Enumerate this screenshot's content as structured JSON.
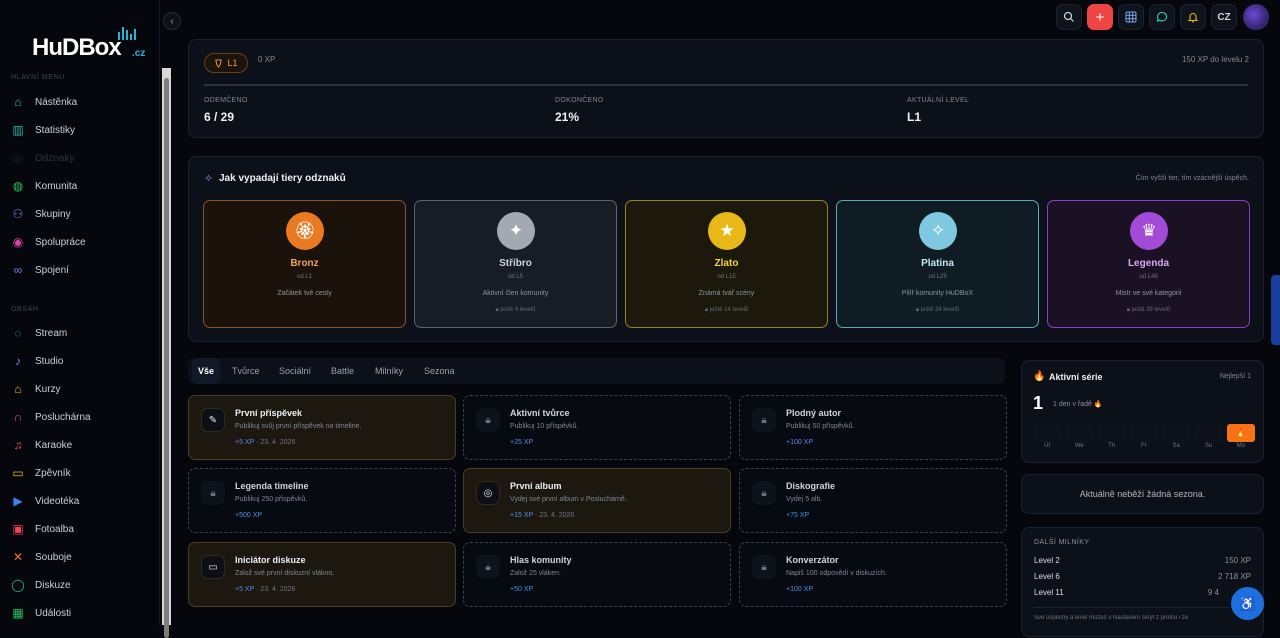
{
  "brand": {
    "name": "HuDBox",
    "tld": ".cz"
  },
  "sidebar": {
    "section_main": "Hlavní menu",
    "section_content": "Obsah",
    "items": [
      {
        "label": "Nástěnka",
        "icon": "home-icon",
        "color": "#22b8a8"
      },
      {
        "label": "Statistiky",
        "icon": "chart-icon",
        "color": "#22b8a8"
      },
      {
        "label": "Odznaky",
        "icon": "medal-icon",
        "color": "#1e2636"
      },
      {
        "label": "Komunita",
        "icon": "globe-icon",
        "color": "#22c55e"
      },
      {
        "label": "Skupiny",
        "icon": "users-icon",
        "color": "#8b7cf6"
      },
      {
        "label": "Spolupráce",
        "icon": "target-icon",
        "color": "#d946a8"
      },
      {
        "label": "Spojení",
        "icon": "link-icon",
        "color": "#8b7cf6"
      },
      {
        "label": "Stream",
        "icon": "broadcast-icon",
        "color": "#22b8a8"
      },
      {
        "label": "Studio",
        "icon": "music-note-icon",
        "color": "#8b7cf6"
      },
      {
        "label": "Kurzy",
        "icon": "graduation-cap-icon",
        "color": "#eab308"
      },
      {
        "label": "Posluchárna",
        "icon": "headphones-icon",
        "color": "#d946a8"
      },
      {
        "label": "Karaoke",
        "icon": "microphone-icon",
        "color": "#f43f5e"
      },
      {
        "label": "Zpěvník",
        "icon": "book-icon",
        "color": "#eab308"
      },
      {
        "label": "Videotéka",
        "icon": "video-icon",
        "color": "#3b82f6"
      },
      {
        "label": "Fotoalba",
        "icon": "image-icon",
        "color": "#f43f5e"
      },
      {
        "label": "Souboje",
        "icon": "swords-icon",
        "color": "#f97316"
      },
      {
        "label": "Diskuze",
        "icon": "chat-icon",
        "color": "#22b8a8"
      },
      {
        "label": "Události",
        "icon": "calendar-icon",
        "color": "#22c55e"
      }
    ]
  },
  "topbar": {
    "lang": "CZ",
    "add_icon": "plus-icon"
  },
  "progress": {
    "level": "L1",
    "xp": "0 XP",
    "to_next": "150 XP do levelu 2",
    "fill_percent": 0,
    "stats": [
      {
        "label": "Odemčeno",
        "value": "6 / 29"
      },
      {
        "label": "Dokončeno",
        "value": "21%"
      },
      {
        "label": "Aktuální level",
        "value": "L1"
      }
    ]
  },
  "tiers": {
    "title": "Jak vypadají tiery odznaků",
    "subtitle": "Čím vyšší tier, tím vzácnější úspěch.",
    "items": [
      {
        "name": "Bronz",
        "from": "od  L1",
        "desc": "Začátek tvé cesty",
        "lock": "",
        "color": "#f0a25a",
        "border": "#8a5520",
        "bg": "#1b130b",
        "circle": "#ea7a22"
      },
      {
        "name": "Stříbro",
        "from": "od  L5",
        "desc": "Aktivní člen komunity",
        "lock": "ještě 4 levelů",
        "color": "#cfd5de",
        "border": "#5b6270",
        "bg": "#181c24",
        "circle": "#a3a8b1"
      },
      {
        "name": "Zlato",
        "from": "od  L15",
        "desc": "Známá tvář scény",
        "lock": "ještě 14 levelů",
        "color": "#f5d04a",
        "border": "#9c8120",
        "bg": "#1c190c",
        "circle": "#e7b818"
      },
      {
        "name": "Platina",
        "from": "od  L25",
        "desc": "Pilíř komunity HuDBoX",
        "lock": "ještě 24 levelů",
        "color": "#bfe8f4",
        "border": "#5aa9bf",
        "bg": "#101c23",
        "circle": "#7ec8e0"
      },
      {
        "name": "Legenda",
        "from": "od  L48",
        "desc": "Mistr ve své kategorii",
        "lock": "ještě 39 levelů",
        "color": "#d9a6f5",
        "border": "#8c3ec0",
        "bg": "#1a1124",
        "circle": "#a24bd6"
      }
    ]
  },
  "tabs": [
    "Vše",
    "Tvůrce",
    "Sociální",
    "Battle",
    "Milníky",
    "Sezona"
  ],
  "achievements": [
    {
      "title": "První příspěvek",
      "desc": "Publikuj svůj první příspěvek na timeline.",
      "xp": "+5 XP",
      "date": "23. 4. 2026",
      "done": true,
      "icon": "pencil-icon"
    },
    {
      "title": "Aktivní tvůrce",
      "desc": "Publikuj 10 příspěvků.",
      "xp": "+25 XP",
      "date": "",
      "done": false,
      "icon": "lock-icon"
    },
    {
      "title": "Plodný autor",
      "desc": "Publikuj 50 příspěvků.",
      "xp": "+100 XP",
      "date": "",
      "done": false,
      "icon": "lock-icon"
    },
    {
      "title": "Legenda timeline",
      "desc": "Publikuj 250 příspěvků.",
      "xp": "+500 XP",
      "date": "",
      "done": false,
      "icon": "lock-icon"
    },
    {
      "title": "První album",
      "desc": "Vydej své první album v Posluchárně.",
      "xp": "+15 XP",
      "date": "23. 4. 2026",
      "done": true,
      "icon": "disc-icon"
    },
    {
      "title": "Diskografie",
      "desc": "Vydej 5 alb.",
      "xp": "+75 XP",
      "date": "",
      "done": false,
      "icon": "lock-icon"
    },
    {
      "title": "Iniciátor diskuze",
      "desc": "Založ své první diskuzní vlákno.",
      "xp": "+5 XP",
      "date": "23. 4. 2026",
      "done": true,
      "icon": "message-icon"
    },
    {
      "title": "Hlas komunity",
      "desc": "Založ 25 vláken.",
      "xp": "+50 XP",
      "date": "",
      "done": false,
      "icon": "lock-icon"
    },
    {
      "title": "Konverzátor",
      "desc": "Napiš 100 odpovědí v diskuzích.",
      "xp": "+100 XP",
      "date": "",
      "done": false,
      "icon": "lock-icon"
    }
  ],
  "streak": {
    "title": "Aktivní série",
    "best": "Nejlepší 1",
    "count": "1",
    "label": "1 den v řadě 🔥",
    "days": [
      {
        "d": "Út",
        "active": false
      },
      {
        "d": "We",
        "active": false
      },
      {
        "d": "Th",
        "active": false
      },
      {
        "d": "Fr",
        "active": false
      },
      {
        "d": "Sa",
        "active": false
      },
      {
        "d": "Su",
        "active": false
      },
      {
        "d": "Mo",
        "active": true
      }
    ]
  },
  "season": {
    "text": "Aktuálně neběží žádná sezona."
  },
  "milestones": {
    "title": "Další milníky",
    "items": [
      {
        "label": "Level 2",
        "value": "150 XP"
      },
      {
        "label": "Level 6",
        "value": "2 718 XP"
      },
      {
        "label": "Level 11",
        "value": "9 4"
      }
    ],
    "note": "Své úspěchy a level můžeš v Nastavení skrýt z profilu i ze"
  }
}
